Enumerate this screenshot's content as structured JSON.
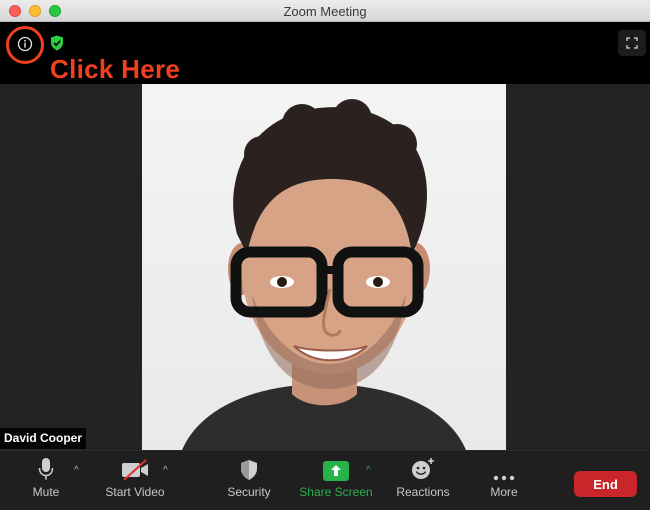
{
  "window": {
    "title": "Zoom Meeting"
  },
  "annotation": {
    "text": "Click Here",
    "color": "#f0401f"
  },
  "participant": {
    "name": "David Cooper"
  },
  "toolbar": {
    "mute_label": "Mute",
    "start_video_label": "Start Video",
    "security_label": "Security",
    "share_screen_label": "Share Screen",
    "reactions_label": "Reactions",
    "more_label": "More",
    "end_label": "End"
  },
  "colors": {
    "share_green": "#26b34a",
    "end_red": "#c8262a",
    "encryption_shield": "#2ecc40"
  },
  "icons": {
    "info": "info-icon",
    "encryption": "shield-check-icon",
    "fullscreen": "fullscreen-icon",
    "mute": "microphone-icon",
    "video": "camera-off-icon",
    "security": "shield-icon",
    "share": "share-arrow-icon",
    "reactions": "smiley-plus-icon",
    "more": "ellipsis-icon"
  }
}
